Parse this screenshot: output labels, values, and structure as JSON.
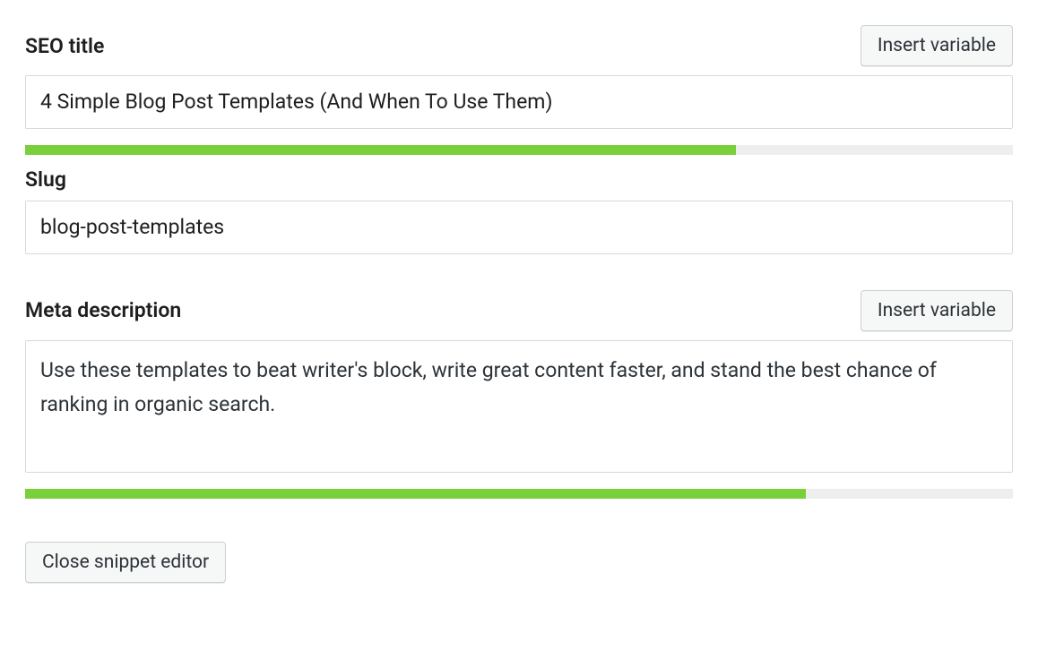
{
  "seoTitle": {
    "label": "SEO title",
    "insertVariableLabel": "Insert variable",
    "value": "4 Simple Blog Post Templates (And When To Use Them)",
    "progressPercent": 72
  },
  "slug": {
    "label": "Slug",
    "value": "blog-post-templates"
  },
  "metaDescription": {
    "label": "Meta description",
    "insertVariableLabel": "Insert variable",
    "value": "Use these templates to beat writer's block, write great content faster, and stand the best chance of ranking in organic search.",
    "progressPercent": 79
  },
  "closeButtonLabel": "Close snippet editor",
  "colors": {
    "progressFill": "#7ad03a",
    "progressBg": "#eeeeee"
  }
}
